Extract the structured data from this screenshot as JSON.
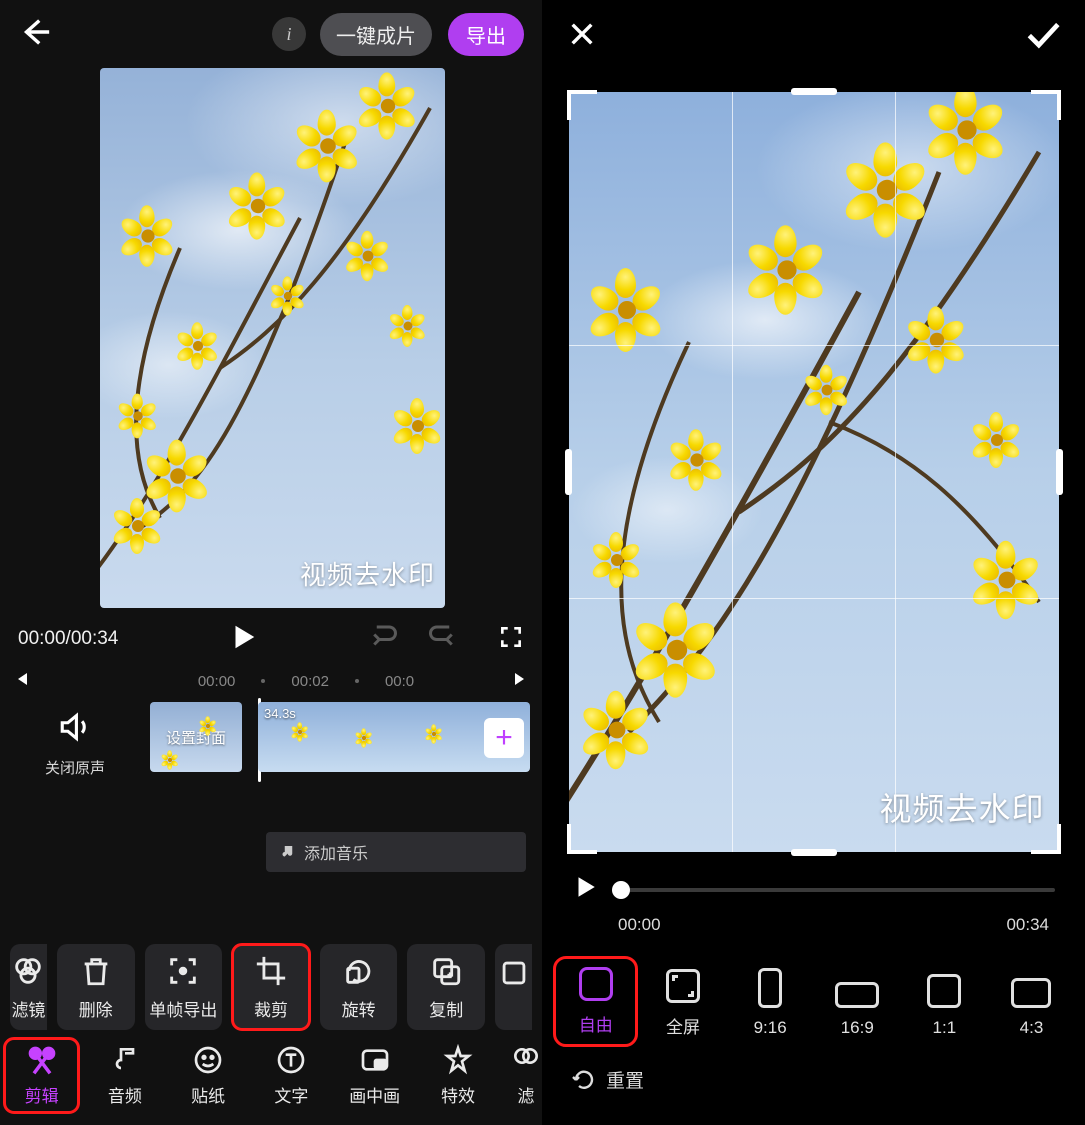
{
  "left": {
    "header": {
      "auto_label": "一键成片",
      "export_label": "导出"
    },
    "preview": {
      "watermark_text": "视频去水印"
    },
    "playback": {
      "time_display": "00:00/00:34"
    },
    "timeline": {
      "tick_labels": [
        "00:00",
        "00:02",
        "00:0"
      ],
      "mute_label": "关闭原声",
      "cover_label": "设置封面",
      "clip_duration": "34.3s",
      "add_music_label": "添加音乐"
    },
    "tools": {
      "filter": "滤镜",
      "delete": "删除",
      "frame_export": "单帧导出",
      "crop": "裁剪",
      "rotate": "旋转",
      "copy": "复制"
    },
    "tabs": {
      "edit": "剪辑",
      "audio": "音频",
      "sticker": "贴纸",
      "text": "文字",
      "pip": "画中画",
      "effects": "特效",
      "filter2": "滤"
    }
  },
  "right": {
    "preview": {
      "watermark_text": "视频去水印"
    },
    "playback": {
      "start": "00:00",
      "end": "00:34"
    },
    "ratios": {
      "free": "自由",
      "full": "全屏",
      "r916": "9:16",
      "r169": "16:9",
      "r11": "1:1",
      "r43": "4:3"
    },
    "reset_label": "重置"
  },
  "colors": {
    "accent": "#b03ef0",
    "highlight": "#ff1a1a"
  }
}
